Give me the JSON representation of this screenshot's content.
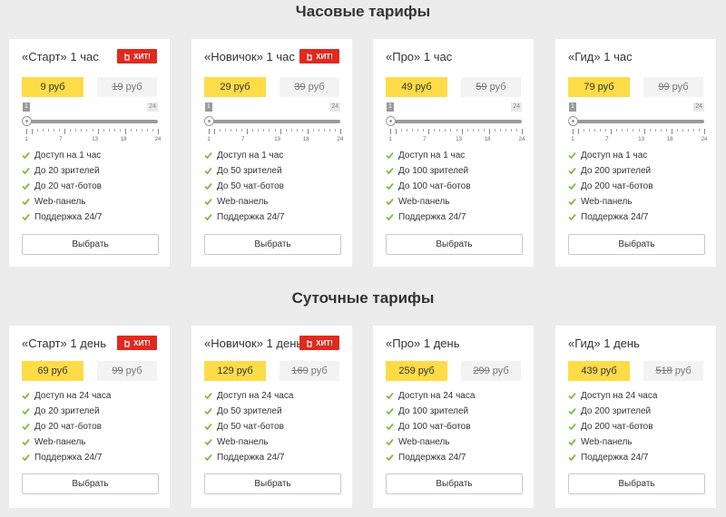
{
  "hourly": {
    "title": "Часовые тарифы",
    "cards": [
      {
        "name": "«Старт» 1 час",
        "hit": true,
        "price_new": "9 руб",
        "price_old": "19",
        "price_old_unit": "руб",
        "slider_min": "1",
        "slider_max": "24",
        "slider_value": 1,
        "features": [
          "Доступ на 1 час",
          "До 20 зрителей",
          "До 20 чат-ботов",
          "Web-панель",
          "Поддержка 24/7"
        ],
        "button": "Выбрать"
      },
      {
        "name": "«Новичок» 1 час",
        "hit": true,
        "price_new": "29 руб",
        "price_old": "39",
        "price_old_unit": "руб",
        "slider_min": "1",
        "slider_max": "24",
        "slider_value": 1,
        "features": [
          "Доступ на 1 час",
          "До 50 зрителей",
          "До 50 чат-ботов",
          "Web-панель",
          "Поддержка 24/7"
        ],
        "button": "Выбрать"
      },
      {
        "name": "«Про» 1 час",
        "hit": false,
        "price_new": "49 руб",
        "price_old": "59",
        "price_old_unit": "руб",
        "slider_min": "1",
        "slider_max": "24",
        "slider_value": 1,
        "features": [
          "Доступ на 1 час",
          "До 100 зрителей",
          "До 100 чат-ботов",
          "Web-панель",
          "Поддержка 24/7"
        ],
        "button": "Выбрать"
      },
      {
        "name": "«Гид» 1 час",
        "hit": false,
        "price_new": "79 руб",
        "price_old": "99",
        "price_old_unit": "руб",
        "slider_min": "1",
        "slider_max": "24",
        "slider_value": 1,
        "features": [
          "Доступ на 1 час",
          "До 200 зрителей",
          "До 200 чат-ботов",
          "Web-панель",
          "Поддержка 24/7"
        ],
        "button": "Выбрать"
      }
    ],
    "tick_labels": [
      "1",
      "7",
      "13",
      "18",
      "24"
    ]
  },
  "daily": {
    "title": "Суточные тарифы",
    "cards": [
      {
        "name": "«Старт» 1 день",
        "hit": true,
        "price_new": "69 руб",
        "price_old": "99",
        "price_old_unit": "руб",
        "features": [
          "Доступ на 24 часа",
          "До 20 зрителей",
          "До 20 чат-ботов",
          "Web-панель",
          "Поддержка 24/7"
        ],
        "button": "Выбрать"
      },
      {
        "name": "«Новичок» 1 день",
        "hit": true,
        "price_new": "129 руб",
        "price_old": "169",
        "price_old_unit": "руб",
        "features": [
          "Доступ на 24 часа",
          "До 50 зрителей",
          "До 50 чат-ботов",
          "Web-панель",
          "Поддержка 24/7"
        ],
        "button": "Выбрать"
      },
      {
        "name": "«Про» 1 день",
        "hit": false,
        "price_new": "259 руб",
        "price_old": "299",
        "price_old_unit": "руб",
        "features": [
          "Доступ на 24 часа",
          "До 100 зрителей",
          "До 100 чат-ботов",
          "Web-панель",
          "Поддержка 24/7"
        ],
        "button": "Выбрать"
      },
      {
        "name": "«Гид» 1 день",
        "hit": false,
        "price_new": "439 руб",
        "price_old": "518",
        "price_old_unit": "руб",
        "features": [
          "Доступ на 24 часа",
          "До 200 зрителей",
          "До 200 чат-ботов",
          "Web-панель",
          "Поддержка 24/7"
        ],
        "button": "Выбрать"
      }
    ]
  },
  "hit_label": "ХИТ!",
  "icons": {
    "badge": "hand-icon",
    "feature": "check-icon",
    "slider": "slider-knob"
  },
  "colors": {
    "accent": "#fedc48",
    "hit": "#e02a1f",
    "check": "#7cbd45",
    "background": "#ececec"
  }
}
